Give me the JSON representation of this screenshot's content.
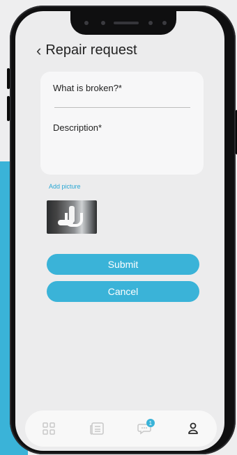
{
  "header": {
    "title": "Repair request",
    "back_icon": "chevron-left-icon"
  },
  "form": {
    "what_broken_label": "What is broken?*",
    "description_label": "Description*"
  },
  "add_picture_label": "Add picture",
  "buttons": {
    "submit": "Submit",
    "cancel": "Cancel"
  },
  "tabbar": {
    "items": [
      "grid-icon",
      "news-icon",
      "chat-icon",
      "user-icon"
    ],
    "chat_badge": "1"
  },
  "colors": {
    "accent": "#3ab3d8",
    "screen_bg": "#ececed",
    "card_bg": "#f7f7f8"
  }
}
